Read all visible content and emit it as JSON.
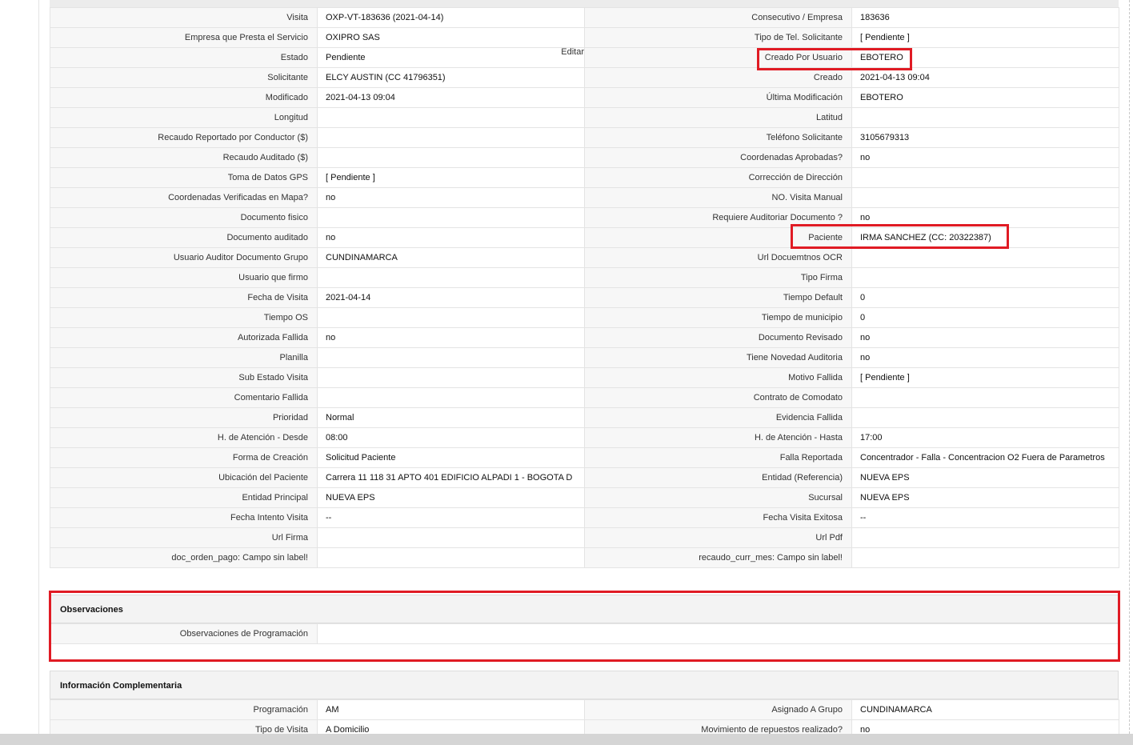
{
  "rows": [
    {
      "l1": "Visita",
      "v1": "OXP-VT-183636 (2021-04-14)",
      "l2": "Consecutivo / Empresa",
      "v2": "183636"
    },
    {
      "l1": "Empresa que Presta el Servicio",
      "v1": "OXIPRO SAS",
      "l2": "Tipo de Tel. Solicitante",
      "v2": "[ Pendiente ]"
    },
    {
      "l1": "Estado",
      "v1": "Pendiente",
      "l2": "Creado Por Usuario",
      "v2": "EBOTERO"
    },
    {
      "l1": "Solicitante",
      "v1": "ELCY AUSTIN (CC 41796351)",
      "l2": "Creado",
      "v2": "2021-04-13 09:04"
    },
    {
      "l1": "Modificado",
      "v1": "2021-04-13 09:04",
      "l2": "Última Modificación",
      "v2": " EBOTERO"
    },
    {
      "l1": "Longitud",
      "v1": "",
      "l2": "Latitud",
      "v2": ""
    },
    {
      "l1": "Recaudo Reportado por Conductor ($)",
      "v1": "",
      "l2": "Teléfono Solicitante",
      "v2": "3105679313"
    },
    {
      "l1": "Recaudo Auditado ($)",
      "v1": "",
      "l2": "Coordenadas Aprobadas?",
      "v2": " no"
    },
    {
      "l1": "Toma de Datos GPS",
      "v1": "[ Pendiente ]",
      "l2": "Corrección de Dirección",
      "v2": ""
    },
    {
      "l1": "Coordenadas Verificadas en Mapa?",
      "v1": " no",
      "l2": "NO. Visita Manual",
      "v2": ""
    },
    {
      "l1": "Documento fisico",
      "v1": "",
      "l2": "Requiere Auditoriar Documento ?",
      "v2": " no"
    },
    {
      "l1": "Documento auditado",
      "v1": " no",
      "l2": "Paciente",
      "v2": "IRMA SANCHEZ (CC: 20322387)"
    },
    {
      "l1": "Usuario Auditor Documento Grupo",
      "v1": "CUNDINAMARCA",
      "l2": "Url Docuemtnos OCR",
      "v2": ""
    },
    {
      "l1": "Usuario que firmo",
      "v1": "",
      "l2": "Tipo Firma",
      "v2": ""
    },
    {
      "l1": "Fecha de Visita",
      "v1": " 2021-04-14",
      "l2": "Tiempo Default",
      "v2": "0"
    },
    {
      "l1": "Tiempo OS",
      "v1": "",
      "l2": "Tiempo de municipio",
      "v2": "0"
    },
    {
      "l1": "Autorizada Fallida",
      "v1": " no",
      "l2": "Documento Revisado",
      "v2": " no"
    },
    {
      "l1": "Planilla",
      "v1": "",
      "l2": "Tiene Novedad Auditoria",
      "v2": " no"
    },
    {
      "l1": "Sub Estado Visita",
      "v1": "",
      "l2": "Motivo Fallida",
      "v2": "[ Pendiente ]"
    },
    {
      "l1": "Comentario Fallida",
      "v1": "",
      "l2": "Contrato de Comodato",
      "v2": ""
    },
    {
      "l1": "Prioridad",
      "v1": "Normal",
      "l2": "Evidencia Fallida",
      "v2": ""
    },
    {
      "l1": "H. de Atención - Desde",
      "v1": "08:00",
      "l2": "H. de Atención - Hasta",
      "v2": "17:00"
    },
    {
      "l1": "Forma de Creación",
      "v1": "Solicitud Paciente",
      "l2": "Falla Reportada",
      "v2": "Concentrador - Falla - Concentracion O2 Fuera de Parametros"
    },
    {
      "l1": "Ubicación del Paciente",
      "v1": "Carrera 11 118 31 APTO 401 EDIFICIO ALPADI 1 - BOGOTA D",
      "l2": "Entidad (Referencia)",
      "v2": "NUEVA EPS"
    },
    {
      "l1": "Entidad Principal",
      "v1": "NUEVA EPS",
      "l2": "Sucursal",
      "v2": "NUEVA EPS"
    },
    {
      "l1": "Fecha Intento Visita",
      "v1": "--",
      "l2": "Fecha Visita Exitosa",
      "v2": "--"
    },
    {
      "l1": "Url Firma",
      "v1": "",
      "l2": "Url Pdf",
      "v2": ""
    },
    {
      "l1": "doc_orden_pago: Campo sin label!",
      "v1": "",
      "l2": "recaudo_curr_mes: Campo sin label!",
      "v2": ""
    }
  ],
  "edit_link": "Editar",
  "observaciones": {
    "title": "Observaciones",
    "label": "Observaciones de Programación",
    "value": ""
  },
  "complementaria": {
    "title": "Información Complementaria",
    "rows": [
      {
        "l1": "Programación",
        "v1": "AM",
        "l2": "Asignado A Grupo",
        "v2": "CUNDINAMARCA"
      },
      {
        "l1": "Tipo de Visita",
        "v1": "A Domicilio",
        "l2": "Movimiento de repuestos realizado?",
        "v2": " no"
      }
    ]
  },
  "colors": {
    "highlight": "#e01b24",
    "label_bg": "#f7f7f7",
    "border": "#e4e4e4"
  }
}
